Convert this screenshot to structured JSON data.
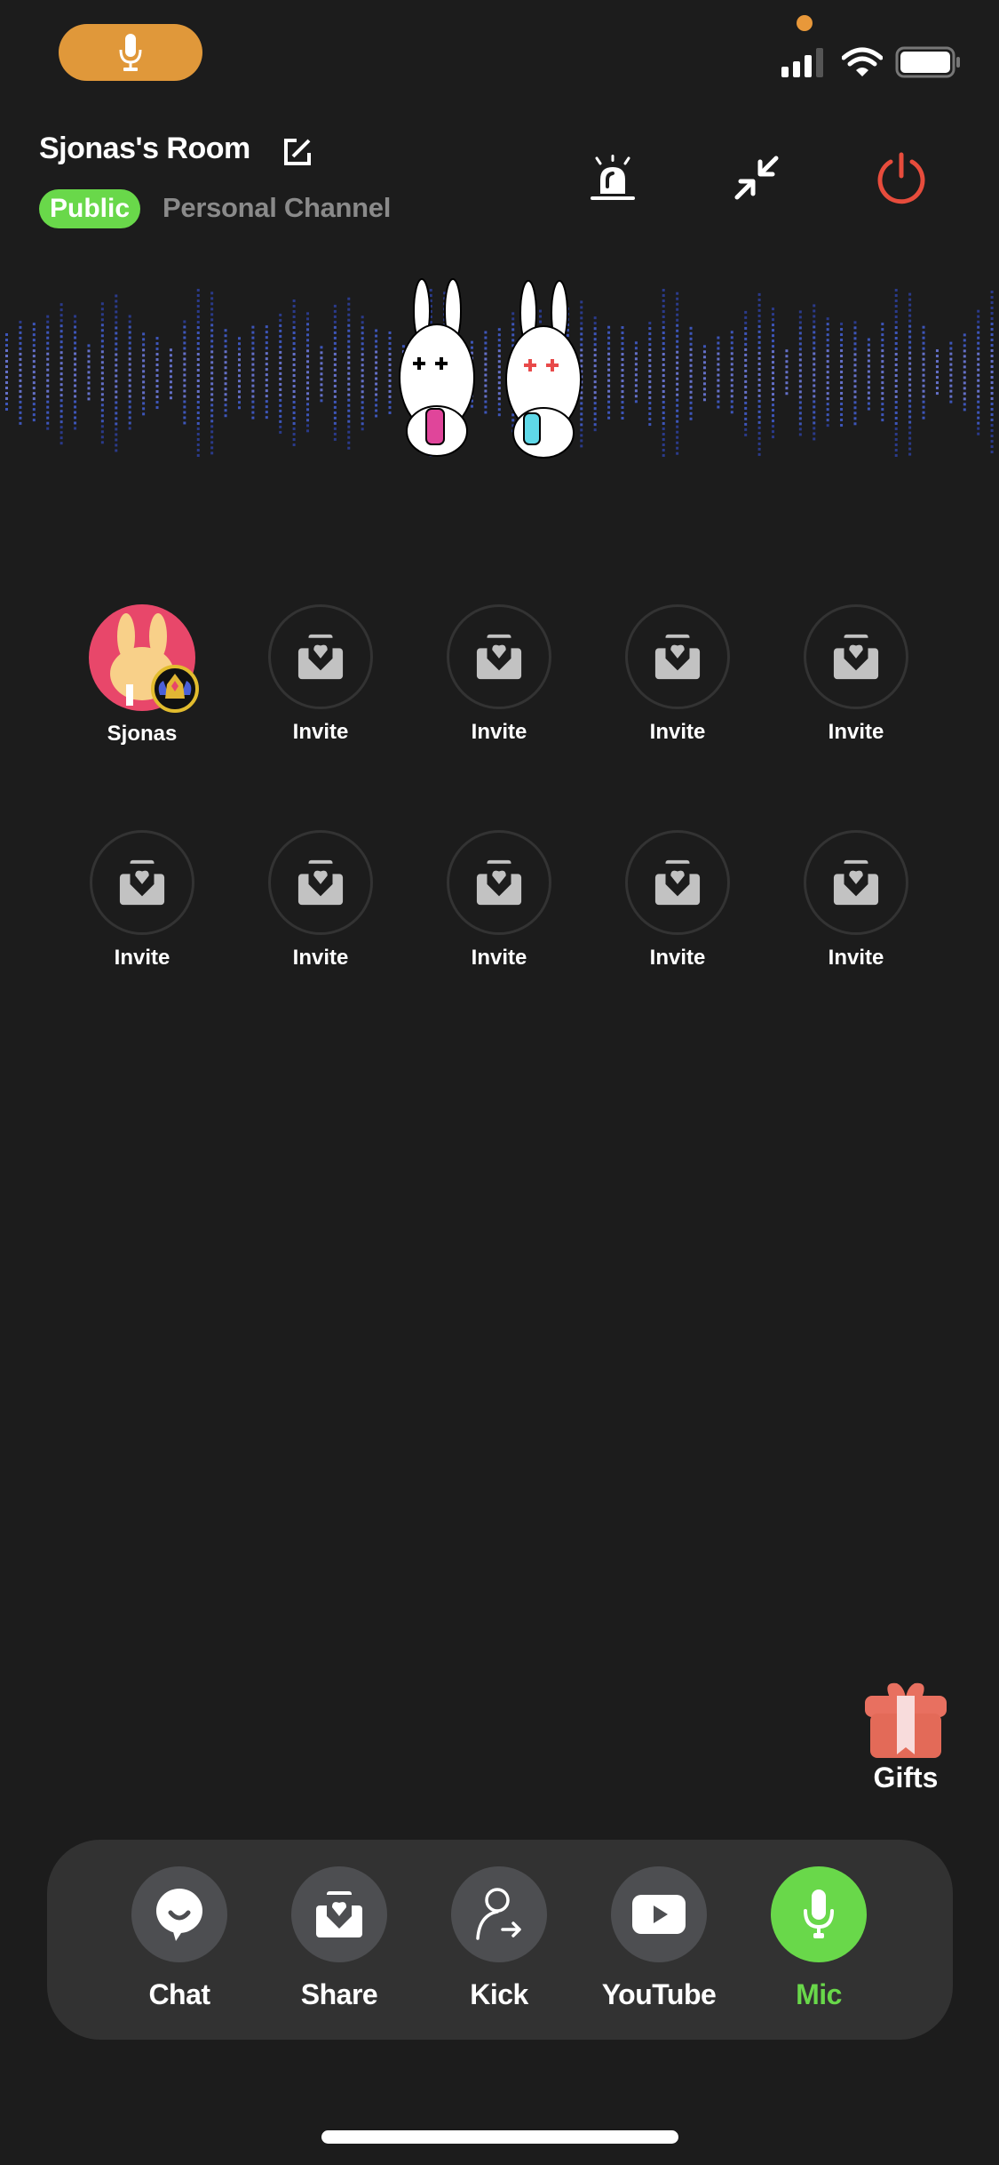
{
  "status_bar": {
    "mic_indicator": "microphone-icon",
    "privacy_dot_color": "#e8983a",
    "icons": [
      "cellular-signal-icon",
      "wifi-icon",
      "battery-icon"
    ]
  },
  "header": {
    "room_title": "Sjonas's Room",
    "edit_icon": "edit-icon",
    "visibility_badge": "Public",
    "channel_label": "Personal Channel",
    "actions": [
      {
        "name": "alarm",
        "icon": "siren-icon"
      },
      {
        "name": "minimize",
        "icon": "minimize-arrows-icon"
      },
      {
        "name": "leave",
        "icon": "power-icon",
        "color": "#e74c3c"
      }
    ]
  },
  "banner": {
    "illustration": "two bunnies holding phones",
    "visualizer": "audio-wave-dots"
  },
  "seats": [
    {
      "label": "Sjonas",
      "occupied": true
    },
    {
      "label": "Invite",
      "occupied": false
    },
    {
      "label": "Invite",
      "occupied": false
    },
    {
      "label": "Invite",
      "occupied": false
    },
    {
      "label": "Invite",
      "occupied": false
    },
    {
      "label": "Invite",
      "occupied": false
    },
    {
      "label": "Invite",
      "occupied": false
    },
    {
      "label": "Invite",
      "occupied": false
    },
    {
      "label": "Invite",
      "occupied": false
    },
    {
      "label": "Invite",
      "occupied": false
    }
  ],
  "gifts": {
    "label": "Gifts"
  },
  "toolbar": {
    "items": [
      {
        "label": "Chat",
        "icon": "chat-bubble-icon",
        "active": false
      },
      {
        "label": "Share",
        "icon": "envelope-heart-icon",
        "active": false
      },
      {
        "label": "Kick",
        "icon": "user-remove-icon",
        "active": false
      },
      {
        "label": "YouTube",
        "icon": "youtube-icon",
        "active": false
      },
      {
        "label": "Mic",
        "icon": "microphone-icon",
        "active": true
      }
    ]
  },
  "colors": {
    "background": "#1c1c1c",
    "accent_green": "#69d84a",
    "mic_pill": "#e0983a",
    "danger": "#e74c3c",
    "toolbar_bg": "#323232"
  }
}
